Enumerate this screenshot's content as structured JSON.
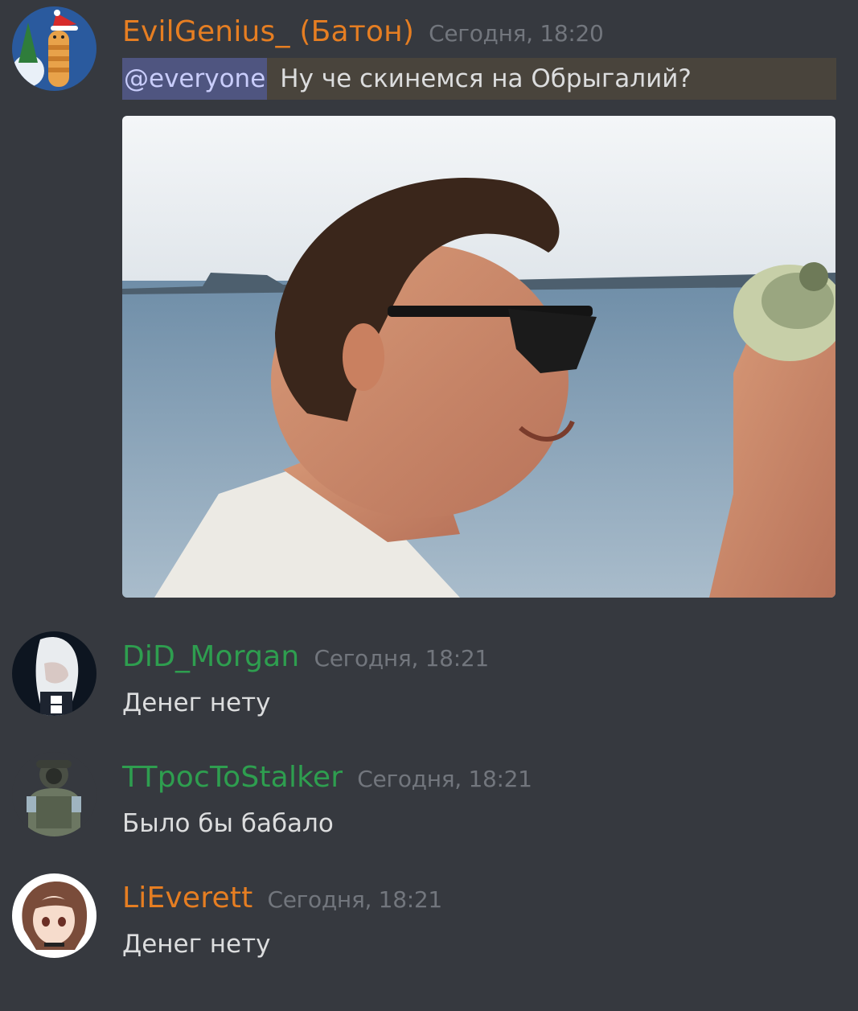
{
  "messages": [
    {
      "username": "EvilGenius_ (Батон)",
      "username_color": "#e67e22",
      "timestamp": "Сегодня, 18:20",
      "mention": "@everyone",
      "text": "Ну че скинемся на Обрыгалий?",
      "attachment": "image-of-man-in-sunglasses-holding-money"
    },
    {
      "username": "DiD_Morgan",
      "username_color": "#2e9e4f",
      "timestamp": "Сегодня, 18:21",
      "text": "Денег нету"
    },
    {
      "username": "TTpocToStalker",
      "username_color": "#2e9e4f",
      "timestamp": "Сегодня, 18:21",
      "text": "Было бы бабало"
    },
    {
      "username": "LiEverett",
      "username_color": "#e67e22",
      "timestamp": "Сегодня, 18:21",
      "text": "Денег нету"
    }
  ]
}
